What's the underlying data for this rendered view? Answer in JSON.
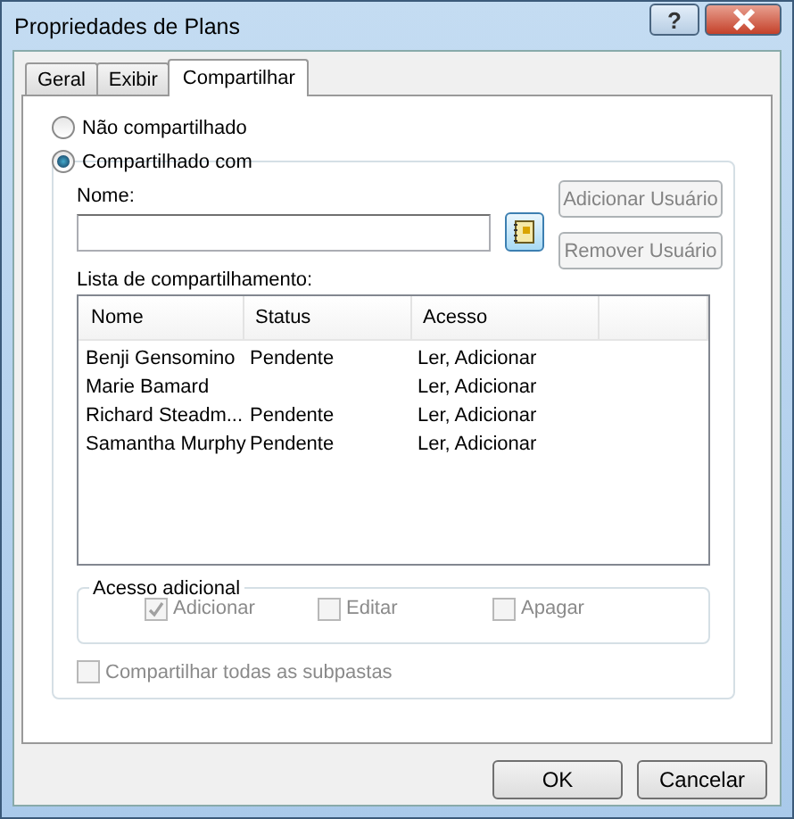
{
  "window": {
    "title": "Propriedades de Plans",
    "help_button": "?"
  },
  "tabs": [
    {
      "label": "Geral",
      "selected": false
    },
    {
      "label": "Exibir",
      "selected": false
    },
    {
      "label": "Compartilhar",
      "selected": true
    }
  ],
  "sharing_options": [
    {
      "label": "Não compartilhado",
      "selected": false
    },
    {
      "label": "Compartilhado com",
      "selected": true
    }
  ],
  "name_field": {
    "label": "Nome:"
  },
  "user_buttons": [
    {
      "label": "Adicionar Usuário",
      "disabled": true
    },
    {
      "label": "Remover Usuário",
      "disabled": true
    }
  ],
  "share_list": {
    "label": "Lista de compartilhamento:",
    "columns": [
      "Nome",
      "Status",
      "Acesso"
    ],
    "rows": [
      [
        "Benji Gensomino",
        "Pendente",
        "Ler, Adicionar"
      ],
      [
        "Marie Bamard",
        "",
        "Ler, Adicionar"
      ],
      [
        "Richard Steadm...",
        "Pendente",
        "Ler, Adicionar"
      ],
      [
        "Samantha Murphy",
        "Pendente",
        "Ler, Adicionar"
      ]
    ]
  },
  "additional_access": {
    "label": "Acesso adicional",
    "options": [
      {
        "label": "Adicionar",
        "checked": true,
        "disabled": true
      },
      {
        "label": "Editar",
        "checked": false,
        "disabled": true
      },
      {
        "label": "Apagar",
        "checked": false,
        "disabled": true
      }
    ]
  },
  "share_subfolders": {
    "label": "Compartilhar todas as subpastas",
    "checked": false,
    "disabled": true
  },
  "buttons": [
    "OK",
    "Cancelar"
  ]
}
